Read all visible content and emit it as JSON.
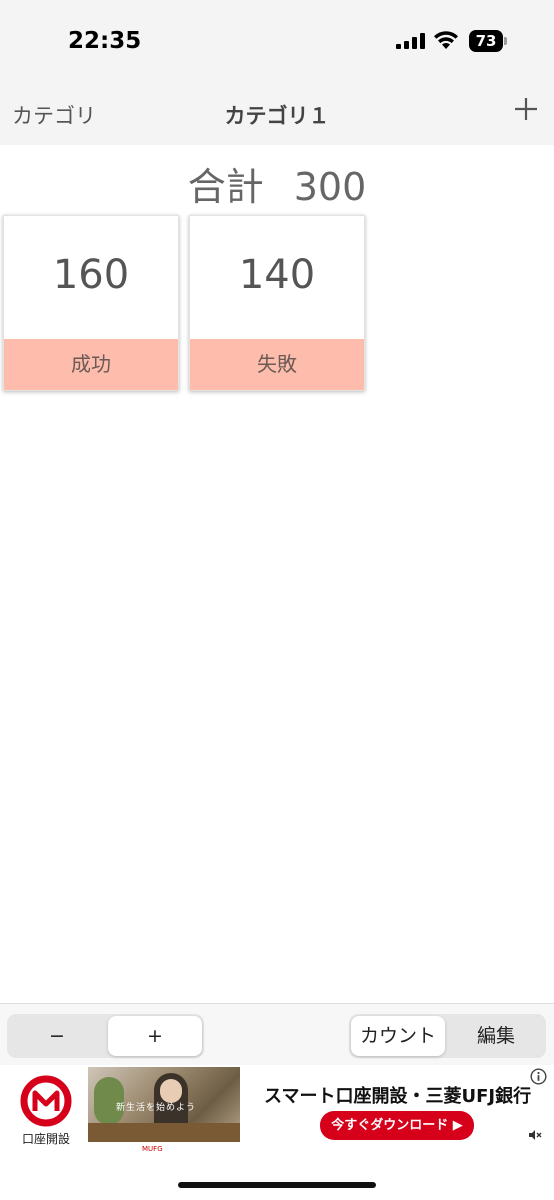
{
  "status_bar": {
    "time": "22:35",
    "battery": "73"
  },
  "nav": {
    "back_label": "カテゴリ",
    "title": "カテゴリ１",
    "add_icon": "plus-icon"
  },
  "total": {
    "label": "合計",
    "value": "300"
  },
  "counters": [
    {
      "label": "成功",
      "count": "160"
    },
    {
      "label": "失敗",
      "count": "140"
    }
  ],
  "toolbar": {
    "decrement_label": "−",
    "increment_label": "+",
    "mode_count_label": "カウント",
    "mode_edit_label": "編集",
    "active_step": "+",
    "active_mode": "カウント"
  },
  "ad": {
    "logo_label": "口座開設",
    "photo_caption": "新生活を始めよう",
    "brand_small": "MUFG",
    "headline": "スマート口座開設・三菱UFJ銀行",
    "cta": "今すぐダウンロード ▶"
  },
  "colors": {
    "counter_label_bg": "#fdbcac",
    "ad_red": "#d7001b",
    "bar_bg": "#f4f4f4"
  }
}
